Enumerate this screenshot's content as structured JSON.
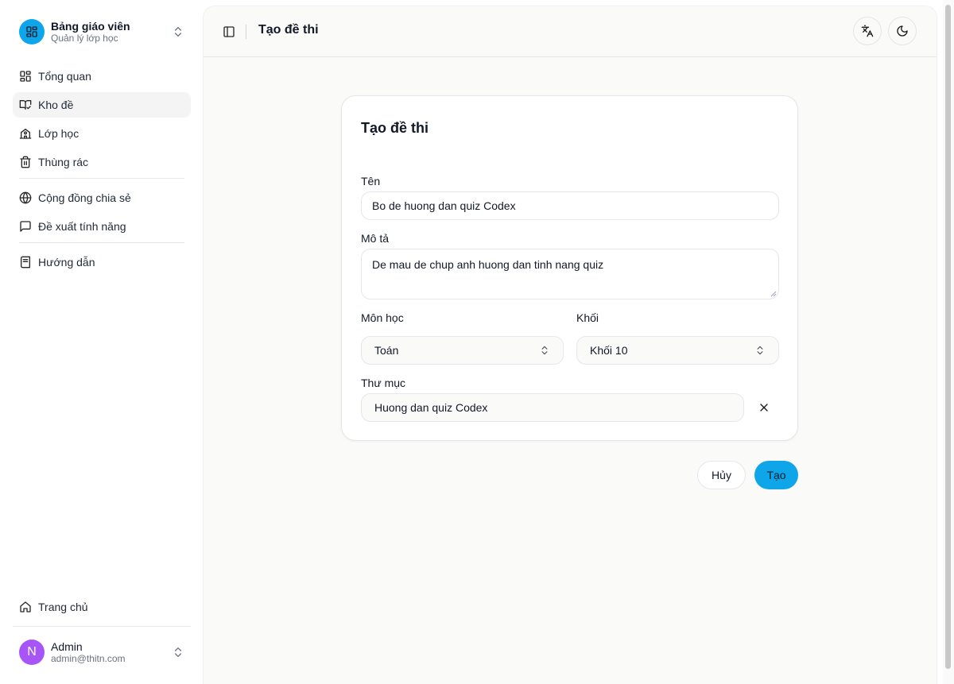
{
  "brand": {
    "title": "Bảng giáo viên",
    "subtitle": "Quản lý lớp học"
  },
  "sidebar": {
    "items": [
      {
        "label": "Tổng quan",
        "icon": "layout-grid-icon"
      },
      {
        "label": "Kho đề",
        "icon": "book-check-icon",
        "active": true
      },
      {
        "label": "Lớp học",
        "icon": "school-icon"
      },
      {
        "label": "Thùng rác",
        "icon": "trash-icon"
      }
    ],
    "community": [
      {
        "label": "Cộng đồng chia sẻ",
        "icon": "globe-icon"
      },
      {
        "label": "Đề xuất tính năng",
        "icon": "message-square-icon"
      }
    ],
    "guide": {
      "label": "Hướng dẫn",
      "icon": "book-icon"
    },
    "home": {
      "label": "Trang chủ",
      "icon": "home-icon"
    }
  },
  "user": {
    "initial": "N",
    "name": "Admin",
    "email": "admin@thitn.com",
    "avatar_color": "#a855f7"
  },
  "header": {
    "title": "Tạo đề thi"
  },
  "form": {
    "title": "Tạo đề thi",
    "name_label": "Tên",
    "name_value": "Bo de huong dan quiz Codex",
    "desc_label": "Mô tả",
    "desc_value": "De mau de chup anh huong dan tinh nang quiz",
    "subject_label": "Môn học",
    "subject_value": "Toán",
    "grade_label": "Khối",
    "grade_value": "Khối 10",
    "folder_label": "Thư mục",
    "folder_value": "Huong dan quiz Codex"
  },
  "actions": {
    "cancel": "Hủy",
    "create": "Tạo"
  },
  "colors": {
    "accent": "#0ea5e9",
    "main_bg": "#fafaf9",
    "avatar": "#a855f7"
  }
}
